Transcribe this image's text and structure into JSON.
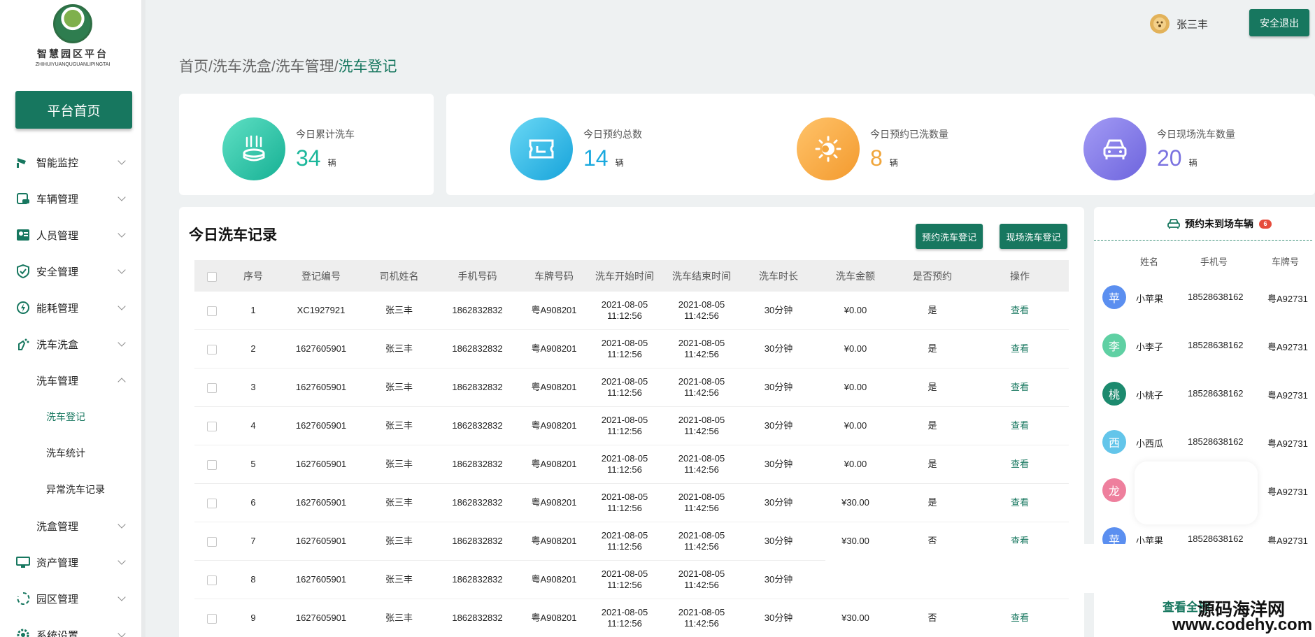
{
  "brand": {
    "name_cn": "智慧园区平台",
    "name_en": "ZHIHUIYUANQUGUANLIPINGTAI"
  },
  "sidebar": {
    "home_button": "平台首页",
    "items": [
      {
        "label": "智能监控",
        "icon": "camera-icon"
      },
      {
        "label": "车辆管理",
        "icon": "calendar-car-icon"
      },
      {
        "label": "人员管理",
        "icon": "people-icon"
      },
      {
        "label": "安全管理",
        "icon": "shield-icon"
      },
      {
        "label": "能耗管理",
        "icon": "energy-icon"
      },
      {
        "label": "洗车洗盒",
        "icon": "spray-icon"
      },
      {
        "label": "洗车管理"
      },
      {
        "label": "洗车登记"
      },
      {
        "label": "洗车统计"
      },
      {
        "label": "异常洗车记录"
      },
      {
        "label": "洗盒管理"
      },
      {
        "label": "资产管理",
        "icon": "monitor-icon"
      },
      {
        "label": "园区管理",
        "icon": "loop-icon"
      },
      {
        "label": "系统设置",
        "icon": "gear-icon"
      }
    ]
  },
  "header": {
    "username": "张三丰",
    "logout": "安全退出"
  },
  "breadcrumb": {
    "items": [
      "首页",
      "洗车洗盒",
      "洗车管理"
    ],
    "current": "洗车登记",
    "separator": "/"
  },
  "stats": [
    {
      "label": "今日累计洗车",
      "value": "34",
      "unit": "辆",
      "color": "#1bb79b"
    },
    {
      "label": "今日预约总数",
      "value": "14",
      "unit": "辆",
      "color": "#1aa9de"
    },
    {
      "label": "今日预约已洗数量",
      "value": "8",
      "unit": "辆",
      "color": "#f0a53a"
    },
    {
      "label": "今日现场洗车数量",
      "value": "20",
      "unit": "辆",
      "color": "#7a72e0"
    }
  ],
  "records": {
    "title": "今日洗车记录",
    "btn_reserve": "预约洗车登记",
    "btn_onsite": "现场洗车登记",
    "columns": [
      "序号",
      "登记编号",
      "司机姓名",
      "手机号码",
      "车牌号码",
      "洗车开始时间",
      "洗车结束时间",
      "洗车时长",
      "洗车金额",
      "是否预约",
      "操作"
    ],
    "rows": [
      [
        "1",
        "XC1927921",
        "张三丰",
        "1862832832",
        "粤A908201",
        "2021-08-05",
        "11:12:56",
        "2021-08-05",
        "11:42:56",
        "30分钟",
        "¥0.00",
        "是",
        "查看"
      ],
      [
        "2",
        "1627605901",
        "张三丰",
        "1862832832",
        "粤A908201",
        "2021-08-05",
        "11:12:56",
        "2021-08-05",
        "11:42:56",
        "30分钟",
        "¥0.00",
        "是",
        "查看"
      ],
      [
        "3",
        "1627605901",
        "张三丰",
        "1862832832",
        "粤A908201",
        "2021-08-05",
        "11:12:56",
        "2021-08-05",
        "11:42:56",
        "30分钟",
        "¥0.00",
        "是",
        "查看"
      ],
      [
        "4",
        "1627605901",
        "张三丰",
        "1862832832",
        "粤A908201",
        "2021-08-05",
        "11:12:56",
        "2021-08-05",
        "11:42:56",
        "30分钟",
        "¥0.00",
        "是",
        "查看"
      ],
      [
        "5",
        "1627605901",
        "张三丰",
        "1862832832",
        "粤A908201",
        "2021-08-05",
        "11:12:56",
        "2021-08-05",
        "11:42:56",
        "30分钟",
        "¥0.00",
        "是",
        "查看"
      ],
      [
        "6",
        "1627605901",
        "张三丰",
        "1862832832",
        "粤A908201",
        "2021-08-05",
        "11:12:56",
        "2021-08-05",
        "11:42:56",
        "30分钟",
        "¥30.00",
        "是",
        "查看"
      ],
      [
        "7",
        "1627605901",
        "张三丰",
        "1862832832",
        "粤A908201",
        "2021-08-05",
        "11:12:56",
        "2021-08-05",
        "11:42:56",
        "30分钟",
        "¥30.00",
        "否",
        "查看"
      ],
      [
        "8",
        "1627605901",
        "张三丰",
        "1862832832",
        "粤A908201",
        "2021-08-05",
        "11:12:56",
        "2021-08-05",
        "11:42:56",
        "30分钟",
        "",
        "",
        ""
      ],
      [
        "9",
        "1627605901",
        "张三丰",
        "1862832832",
        "粤A908201",
        "2021-08-05",
        "11:12:56",
        "2021-08-05",
        "11:42:56",
        "30分钟",
        "¥30.00",
        "否",
        "查看"
      ]
    ]
  },
  "no_show": {
    "title": "预约未到场车辆",
    "badge": "6",
    "columns": [
      "姓名",
      "手机号",
      "车牌号"
    ],
    "rows": [
      {
        "avatar": "苹",
        "name": "小苹果",
        "phone": "18528638162",
        "plate": "粤A92731",
        "color": "#5b8ff0"
      },
      {
        "avatar": "李",
        "name": "小李子",
        "phone": "18528638162",
        "plate": "粤A92731",
        "color": "#5fd0a3"
      },
      {
        "avatar": "桃",
        "name": "小桃子",
        "phone": "18528638162",
        "plate": "粤A92731",
        "color": "#1c8a6e"
      },
      {
        "avatar": "西",
        "name": "小西瓜",
        "phone": "18528638162",
        "plate": "粤A92731",
        "color": "#63c5ea"
      },
      {
        "avatar": "龙",
        "name": "",
        "phone": "",
        "plate": "粤A92731",
        "color": "#ee7f9d"
      },
      {
        "avatar": "苹",
        "name": "小苹果",
        "phone": "18528638162",
        "plate": "粤A92731",
        "color": "#5b8ff0"
      }
    ],
    "more": "查看全部"
  },
  "watermark": {
    "cn": "源码海洋网",
    "url": "www.codehy.com"
  }
}
